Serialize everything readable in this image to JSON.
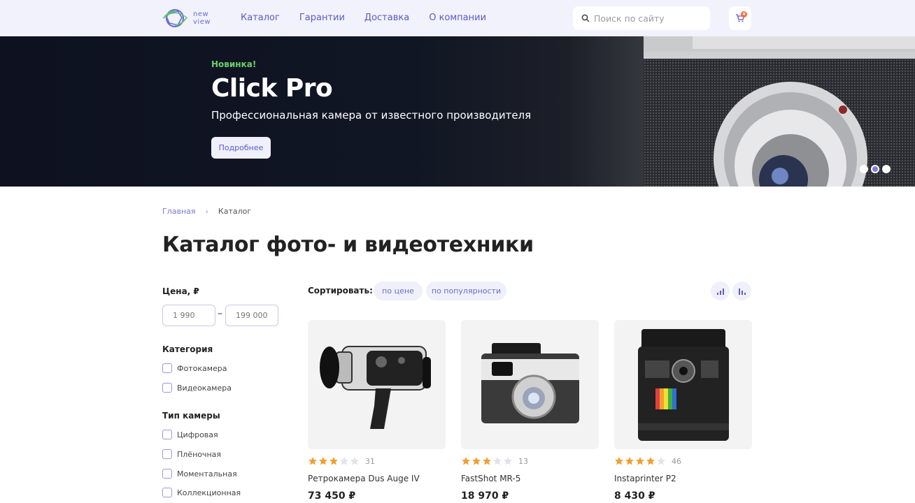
{
  "brand": {
    "logo_line1": "new",
    "logo_line2": "view"
  },
  "nav": [
    "Каталог",
    "Гарантии",
    "Доставка",
    "О компании"
  ],
  "search": {
    "placeholder": "Поиск по сайту"
  },
  "cart": {
    "count": "4"
  },
  "hero": {
    "badge": "Новинка!",
    "title": "Click Pro",
    "subtitle": "Профессиональная камера от известного производителя",
    "button": "Подробнее",
    "slides": 3,
    "active_slide": 2
  },
  "breadcrumb": {
    "home": "Главная",
    "separator": "›",
    "current": "Каталог"
  },
  "page_title": "Каталог фото- и видеотехники",
  "filters": {
    "price": {
      "label": "Цена, ₽",
      "min_placeholder": "1 990",
      "max_placeholder": "199 000",
      "dash": "–"
    },
    "category": {
      "label": "Категория",
      "options": [
        "Фотокамера",
        "Видеокамера"
      ]
    },
    "camera_type": {
      "label": "Тип камеры",
      "options": [
        "Цифровая",
        "Плёночная",
        "Моментальная",
        "Коллекционная"
      ]
    }
  },
  "sort": {
    "label": "Сортировать:",
    "options": [
      "по цене",
      "по популярности"
    ]
  },
  "colors": {
    "accent": "#5a5ac8",
    "star_filled": "#f0a030",
    "star_empty": "#e2e2ea",
    "badge": "#ff6a3d",
    "hero_badge": "#6ad06a"
  },
  "products": [
    {
      "name": "Ретрокамера Dus Auge IV",
      "price": "73 450 ₽",
      "rating": 3,
      "reviews": "31",
      "icon": "movie-camera-image"
    },
    {
      "name": "FastShot MR-5",
      "price": "18 970 ₽",
      "rating": 3,
      "reviews": "13",
      "icon": "film-camera-image"
    },
    {
      "name": "Instaprinter P2",
      "price": "8 430 ₽",
      "rating": 4,
      "reviews": "46",
      "icon": "instant-camera-image"
    }
  ]
}
